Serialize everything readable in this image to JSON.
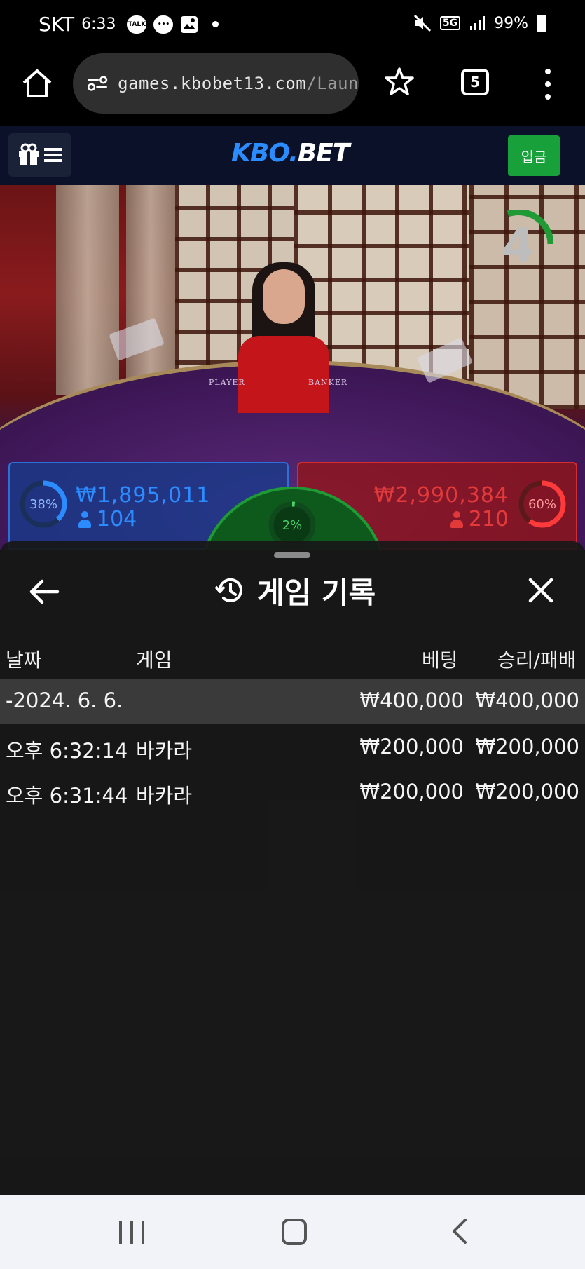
{
  "status_bar": {
    "carrier": "SKT",
    "time": "6:33",
    "talk_icon_text": "TALK",
    "network": "5G",
    "battery": "99%"
  },
  "browser": {
    "url_host": "games.kbobet13.com",
    "url_path": "/Laun",
    "tab_count": "5"
  },
  "site": {
    "logo_part1": "KBO.",
    "logo_part2": "BET",
    "deposit_label": "입금"
  },
  "game": {
    "countdown": "4",
    "table_player_text": "PLAYER",
    "table_banker_text": "BANKER",
    "player": {
      "percent": "38%",
      "percent_value": 0.38,
      "amount": "₩1,895,011",
      "count": "104"
    },
    "banker": {
      "percent": "60%",
      "percent_value": 0.6,
      "amount": "₩2,990,384",
      "count": "210"
    },
    "tie": {
      "percent": "2%",
      "percent_value": 0.02
    }
  },
  "history": {
    "title": "게임 기록",
    "columns": {
      "date": "날짜",
      "game": "게임",
      "bet": "베팅",
      "result": "승리/패배"
    },
    "summary": {
      "date": "-2024. 6. 6.",
      "bet": "₩400,000",
      "result": "₩400,000"
    },
    "rows": [
      {
        "time": "오후 6:32:14",
        "game": "바카라",
        "bet": "₩200,000",
        "result": "₩200,000"
      },
      {
        "time": "오후 6:31:44",
        "game": "바카라",
        "bet": "₩200,000",
        "result": "₩200,000"
      }
    ]
  },
  "colors": {
    "player_blue": "#2c6fd6",
    "banker_red": "#d62c2c",
    "tie_green": "#1f9a35",
    "deposit_green": "#18a03a",
    "logo_blue": "#2a8cff"
  },
  "icons": {
    "home": "home-icon",
    "site_settings": "tune-icon",
    "bookmark": "star-icon",
    "menu": "more-vert-icon",
    "gift_menu": "gift-menu-icon",
    "back": "arrow-left-icon",
    "history": "history-icon",
    "close": "close-icon"
  }
}
